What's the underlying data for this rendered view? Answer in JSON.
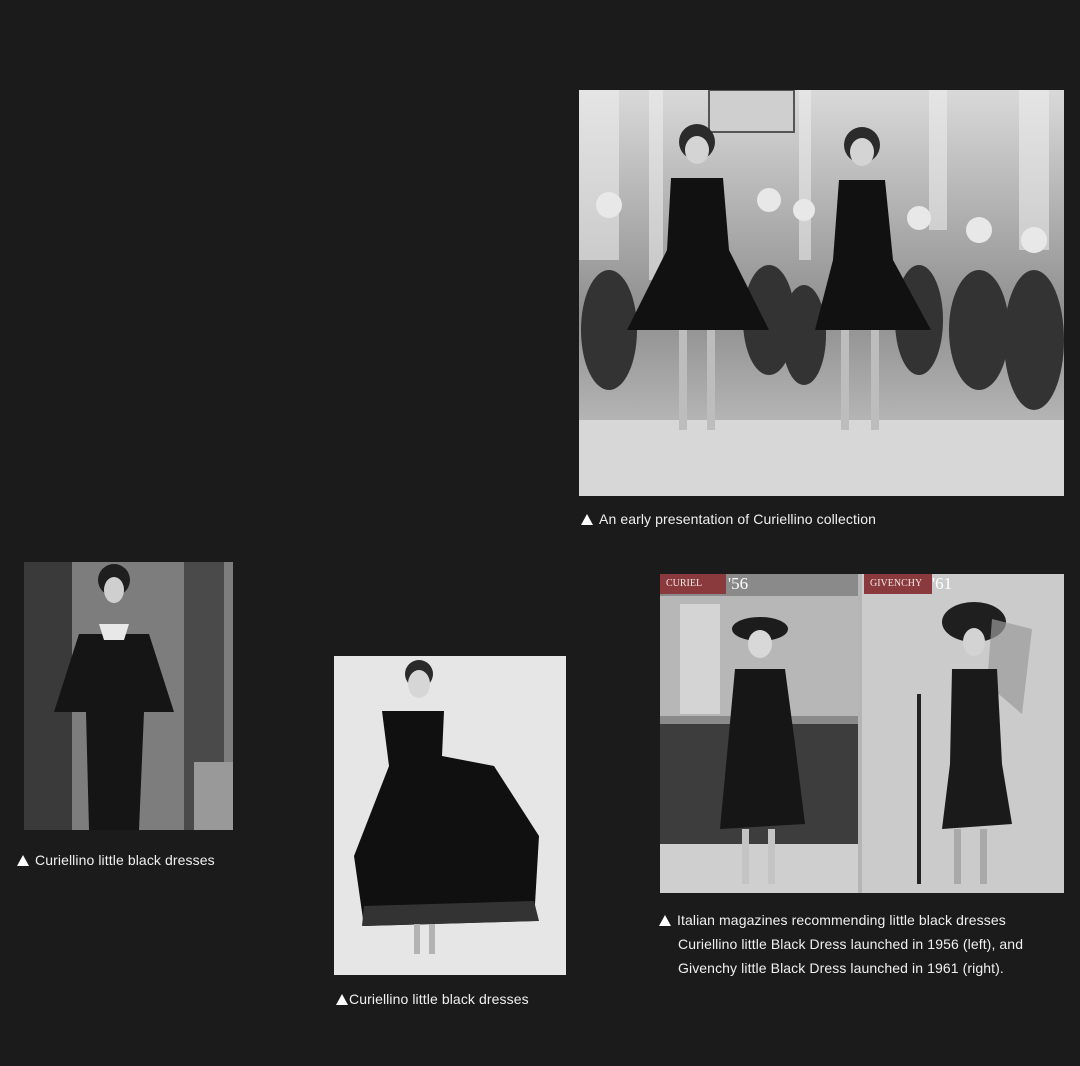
{
  "photos": {
    "presentation": {
      "alt": ""
    },
    "dress_left": {
      "alt": ""
    },
    "dress_center": {
      "alt": ""
    },
    "magazines": {
      "left_brand": "CURIEL",
      "left_year": "'56",
      "right_brand": "GIVENCHY",
      "right_year": "'61"
    }
  },
  "captions": {
    "presentation": "An early presentation of Curiellino collection",
    "dress_left": "Curiellino little black dresses",
    "dress_center": "Curiellino little black dresses",
    "magazines_line1": "Italian magazines recommending little black dresses",
    "magazines_line2": "Curiellino little Black Dress launched in 1956 (left), and",
    "magazines_line3": "Givenchy little Black Dress launched in 1961 (right)."
  },
  "colors": {
    "background": "#1b1b1b",
    "caption_text": "#f0f0f0",
    "magazine_label": "#8a3a3d"
  }
}
